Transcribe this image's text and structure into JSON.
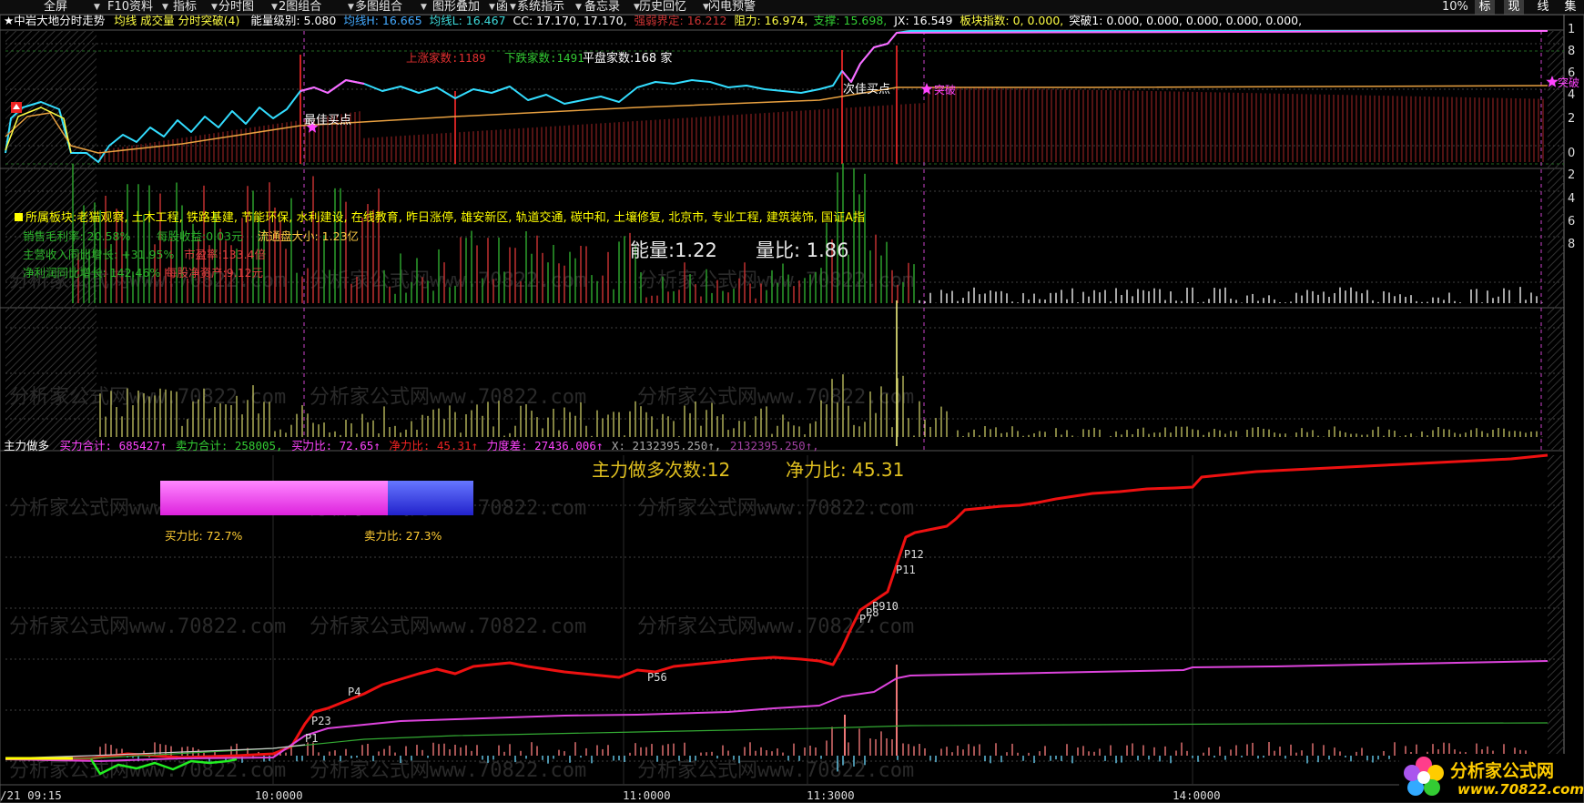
{
  "toolbar": {
    "items": [
      "全屏",
      "F10资料",
      "指标",
      "分时图",
      "2图组合",
      "多图组合",
      "图形叠加",
      "函",
      "系统指示",
      "备忘录",
      "历史回忆",
      "闪电预警"
    ],
    "zoom": "10%",
    "right_tabs": [
      "标",
      "现",
      "线",
      "集"
    ]
  },
  "main_header": {
    "title": "★中岩大地分时走势",
    "indicator_name": "均线 成交量 分时突破(4)",
    "energy_level_label": "能量级别:",
    "energy_level_value": "5.080",
    "avg_h": "均线H: 16.665",
    "avg_l": "均线L: 16.467",
    "cc": "CC: 17.170, 17.170,",
    "strong_weak": "强弱界定: 16.212",
    "resistance": "阻力: 16.974,",
    "support": "支撑: 15.698,",
    "jx": "JX: 16.549",
    "sector_index": "板块指数: 0, 0.000,",
    "breakout": "突破1: 0.000, 0.000, 0.000, 0.000, 0.000,"
  },
  "breadth": {
    "up": "上涨家数:1189",
    "down": "下跌家数:1491",
    "flat": "平盘家数:168 家"
  },
  "annotations": {
    "best_buy": "最佳买点",
    "second_buy": "次佳买点",
    "breakout_mark": "突破",
    "breakout_mark_right": "突破"
  },
  "right_scale": [
    "1",
    "8",
    "6",
    "4",
    "2",
    "0",
    "2",
    "4",
    "6",
    "8"
  ],
  "info_panel": {
    "sector_label": "所属板块:",
    "sectors": "老猫观察, 土木工程, 铁路基建, 节能环保, 水利建设, 在线教育, 昨日涨停, 雄安新区, 轨道交通, 碳中和, 土壤修复, 北京市, 专业工程, 建筑装饰, 国证A指",
    "gross_margin": "销售毛利率: 20.58%",
    "eps": "每股收益:0.03元",
    "float_cap": "流通盘大小: 1.23亿",
    "revenue_growth": "主营收入同比增长: +31.95%",
    "pe": "市盈率:133.4倍",
    "profit_growth": "净利润同比增长: 142.46%",
    "net_assets": "每股净资产:9.12元",
    "energy": "能量:1.22",
    "volume_ratio": "量比: 1.86"
  },
  "force_header": {
    "name": "主力做多",
    "buy_total": "买力合计: 685427↑",
    "sell_total": "卖力合计: 258005,",
    "buy_ratio": "买力比: 72.65↑",
    "net_ratio": "净力比: 45.31↑",
    "strength_diff": "力度差: 27436.006↑",
    "x_val": "X: 2132395.250↑,",
    "x_val2": "2132395.250↑,"
  },
  "force_panel": {
    "long_count": "主力做多次数:12",
    "net_ratio": "净力比: 45.31",
    "buy_ratio_label": "买力比:  72.7%",
    "sell_ratio_label": "卖力比:  27.3%",
    "buy_ratio": 0.727,
    "sell_ratio": 0.273,
    "points": [
      "P1",
      "P23",
      "P4",
      "P56",
      "P7",
      "P8",
      "P910",
      "P11",
      "P12"
    ]
  },
  "time_axis": [
    "/21 09:15",
    "10:0000",
    "11:0000",
    "11:3000",
    "14:0000"
  ],
  "watermark": "分析家公式网www.70822.com",
  "logo": {
    "name": "分析家公式网",
    "url": "www.70822.com"
  },
  "colors": {
    "price_line": "#33ddff",
    "avg_line": "#e8a040",
    "buy_bar": "#ff44ff",
    "sell_bar": "#3333ee",
    "force_line": "#ee1111",
    "magenta_line": "#dd44dd"
  },
  "chart_data": [
    {
      "type": "line",
      "title": "中岩大地分时走势",
      "series": [
        {
          "name": "均线H",
          "values": [
            16.665
          ]
        },
        {
          "name": "均线L",
          "values": [
            16.467
          ]
        }
      ]
    },
    {
      "type": "line",
      "title": "主力做多",
      "series": [
        {
          "name": "买力合计",
          "values": [
            685427
          ]
        },
        {
          "name": "卖力合计",
          "values": [
            258005
          ]
        }
      ]
    }
  ]
}
